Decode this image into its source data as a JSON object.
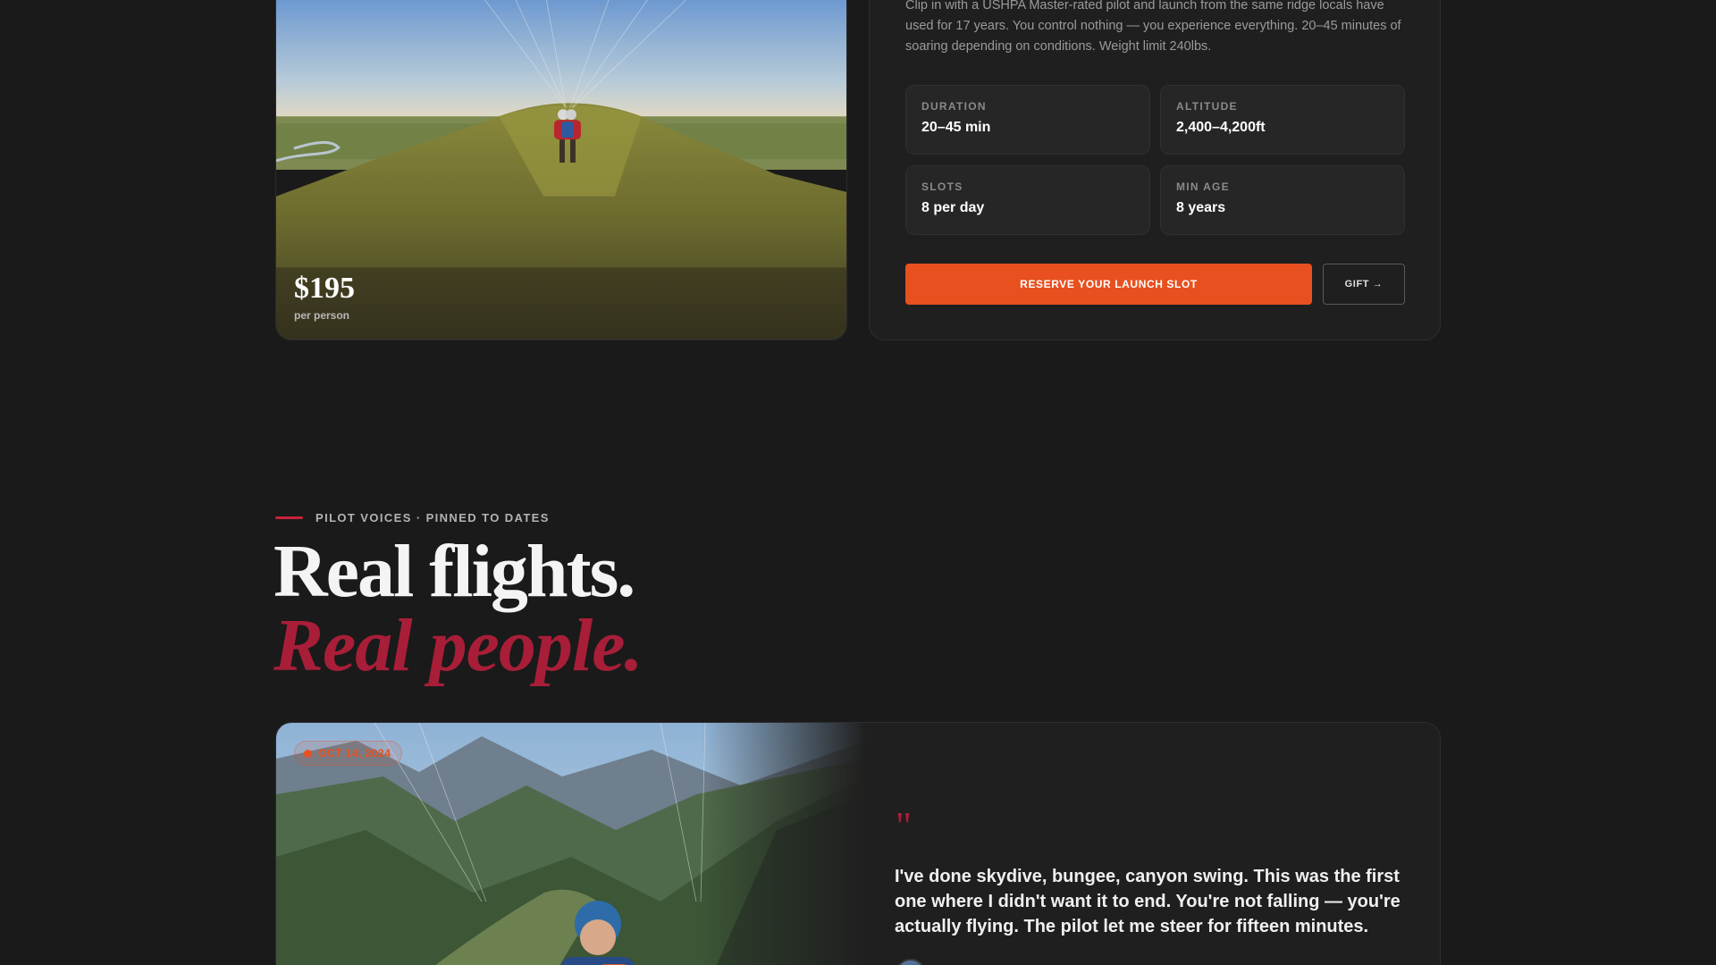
{
  "product": {
    "description": "Clip in with a USHPA Master-rated pilot and launch from the same ridge locals have used for 17 years. You control nothing — you experience everything. 20–45 minutes of soaring depending on conditions. Weight limit 240lbs.",
    "price": "$195",
    "price_unit": "per person",
    "stats": [
      {
        "label": "DURATION",
        "value": "20–45 min"
      },
      {
        "label": "ALTITUDE",
        "value": "2,400–4,200ft"
      },
      {
        "label": "SLOTS",
        "value": "8 per day"
      },
      {
        "label": "MIN AGE",
        "value": "8 years"
      }
    ],
    "reserve_label": "RESERVE YOUR LAUNCH SLOT",
    "gift_label": "GIFT →"
  },
  "voices": {
    "eyebrow": "PILOT VOICES · PINNED TO DATES",
    "headline": "Real flights.",
    "headline_accent": "Real people.",
    "testimonial": {
      "date": "OCT 14, 2024",
      "quote_mark": "\"",
      "quote": "I've done skydive, bungee, canyon swing. This was the first one where I didn't want it to end. You're not falling — you're actually flying. The pilot let me steer for fifteen minutes."
    }
  },
  "colors": {
    "background": "#1a1a1a",
    "accent_orange": "#e8501f",
    "accent_red": "#a81e38"
  }
}
